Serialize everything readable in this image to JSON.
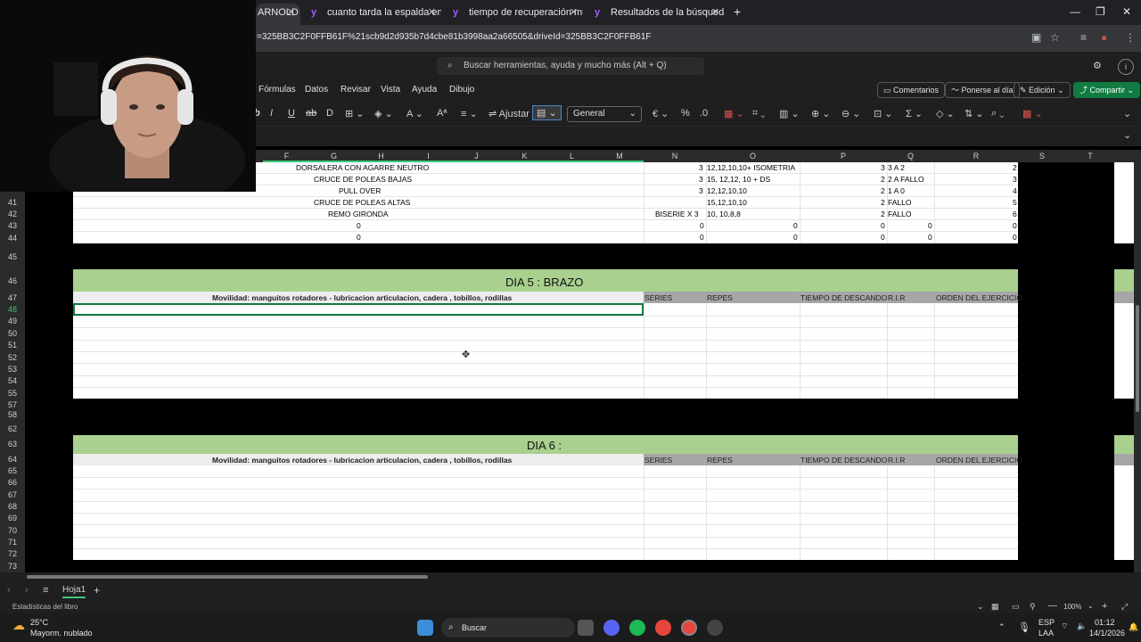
{
  "browser": {
    "tabs": [
      {
        "label": "ARNOLD",
        "active": true
      },
      {
        "label": "cuanto tarda la espalda en recu"
      },
      {
        "label": "tiempo de recuperación muscu"
      },
      {
        "label": "Resultados de la búsqueda de"
      }
    ],
    "new_tab": "+",
    "url": "=325BB3C2F0FFB61F%21scb9d2d935b7d4cbe81b3998aa2a66505&driveId=325BB3C2F0FFB61F"
  },
  "excel": {
    "search_placeholder": "Buscar herramientas, ayuda y mucho más (Alt + Q)",
    "ribbon_tabs": [
      "Fórmulas",
      "Datos",
      "Revisar",
      "Vista",
      "Ayuda",
      "Dibujo"
    ],
    "comments": "Comentarios",
    "catchup": "Ponerse al día",
    "edit_mode": "Edición",
    "share": "Compartir",
    "wrap": "Ajustar",
    "number_format": "General",
    "columns": [
      "F",
      "G",
      "H",
      "I",
      "J",
      "K",
      "L",
      "M",
      "N",
      "O",
      "P",
      "Q",
      "R",
      "S",
      "T"
    ],
    "rows_top": [
      {
        "n": "",
        "ex": "DORSALERA CON AGARRE NEUTRO",
        "n_val": "3",
        "o_val": "12,12,10,10+ ISOMETRIA",
        "p_val": "3",
        "q_val": "3 A 2",
        "r_val": "2"
      },
      {
        "n": "",
        "ex": "CRUCE DE POLEAS BAJAS",
        "n_val": "3",
        "o_val": "15, 12,12, 10 + DS",
        "p_val": "2",
        "q_val": "2 A FALLO",
        "r_val": "3"
      },
      {
        "n": "",
        "ex": "PULL OVER",
        "n_val": "3",
        "o_val": "12,12,10,10",
        "p_val": "2",
        "q_val": "1 A 0",
        "r_val": "4"
      },
      {
        "n": "41",
        "ex": "CRUCE DE POLEAS ALTAS",
        "n_val": "",
        "o_val": "15,12,10,10",
        "p_val": "2",
        "q_val": "FALLO",
        "r_val": "5"
      },
      {
        "n": "42",
        "ex": "REMO GIRONDA",
        "n_val": "BISERIE X 3",
        "o_val": "10, 10,8,8",
        "p_val": "2",
        "q_val": "FALLO",
        "r_val": "6"
      },
      {
        "n": "43",
        "ex": "0",
        "n_val": "0",
        "o_val": "0",
        "p_val": "0",
        "q_val": "0",
        "r_val": "0"
      },
      {
        "n": "44",
        "ex": "0",
        "n_val": "0",
        "o_val": "0",
        "p_val": "0",
        "q_val": "0",
        "r_val": "0"
      }
    ],
    "day5": {
      "title": "DIA 5 : BRAZO",
      "mobility": "Movilidad: manguitos rotadores - lubricacion articulacion, cadera , tobillos, rodillas",
      "headers": [
        "SERIES",
        "REPES",
        "TIEMPO DE DESCANDO",
        "R.I.R",
        "ORDEN DEL EJERCICIO"
      ]
    },
    "day6": {
      "title": "DIA 6 :",
      "mobility": "Movilidad: manguitos rotadores - lubricacion articulacion, cadera , tobillos, rodillas",
      "headers": [
        "SERIES",
        "REPES",
        "TIEMPO DE DESCANDO",
        "R.I.R",
        "ORDEN DEL EJERCICIO"
      ]
    },
    "row_numbers": [
      "41",
      "42",
      "43",
      "44",
      "45",
      "46",
      "47",
      "48",
      "49",
      "50",
      "51",
      "52",
      "53",
      "54",
      "55",
      "57",
      "58",
      "62",
      "63",
      "64",
      "65",
      "66",
      "67",
      "68",
      "69",
      "70",
      "71",
      "72",
      "73"
    ],
    "selected_row": "48",
    "sheet_tab": "Hoja1",
    "status_left": "Estadísticas del libro",
    "zoom": "100%"
  },
  "taskbar": {
    "weather_temp": "25°C",
    "weather_desc": "Mayorm. nublado",
    "search": "Buscar",
    "lang1": "ESP",
    "lang2": "LAA",
    "time": "01:12",
    "date": "14/1/2026"
  }
}
